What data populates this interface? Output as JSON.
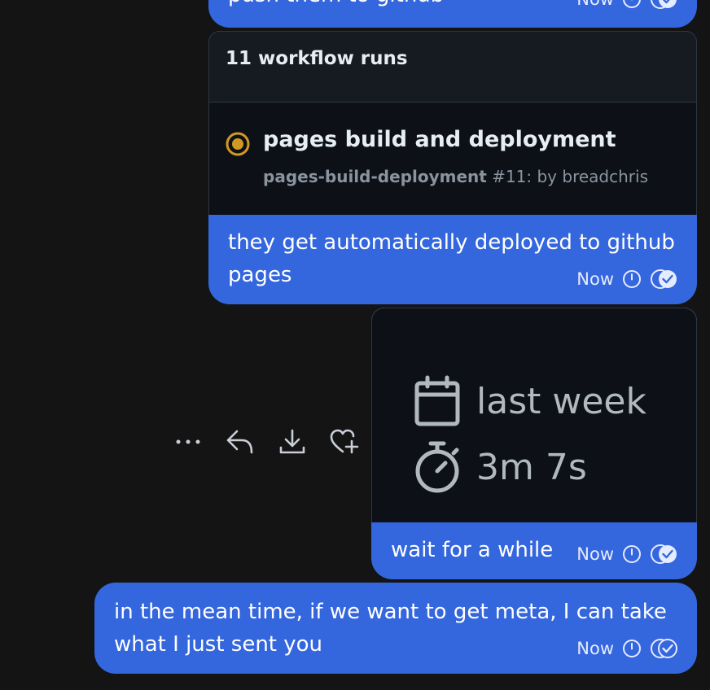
{
  "messages": [
    {
      "text": "push them to github",
      "time": "Now"
    },
    {
      "card": {
        "header": "11 workflow runs",
        "run_title": "pages build and deployment",
        "run_workflow": "pages-build-deployment",
        "run_meta": " #11: by breadchris"
      },
      "text": "they get automatically deployed to github pages",
      "time": "Now"
    },
    {
      "image": {
        "line1": "last week",
        "line2": "3m 7s"
      },
      "text": "wait for a while",
      "time": "Now"
    },
    {
      "text": "in the mean time, if we want to get meta, I can take what I just sent you",
      "time": "Now"
    }
  ],
  "colors": {
    "bubble": "#3466dd",
    "background": "#141414",
    "card_bg": "#0d1117",
    "status_in_progress": "#d29922"
  },
  "actions": [
    "more-icon",
    "reply-icon",
    "download-icon",
    "react-icon"
  ]
}
